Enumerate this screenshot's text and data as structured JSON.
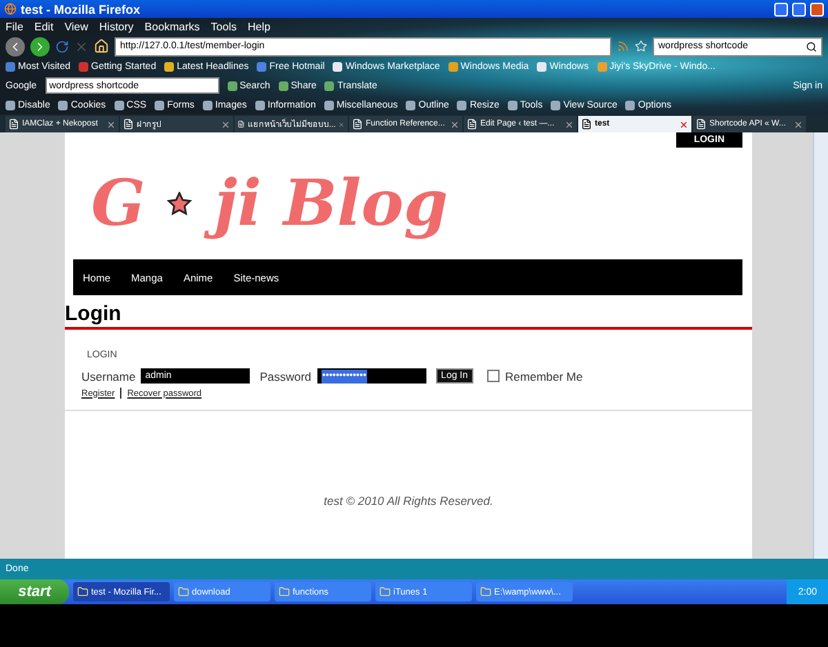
{
  "window": {
    "title": "test - Mozilla Firefox"
  },
  "menu": [
    "File",
    "Edit",
    "View",
    "History",
    "Bookmarks",
    "Tools",
    "Help"
  ],
  "address": {
    "url": "http://127.0.0.1/test/member-login"
  },
  "search": {
    "value": "wordpress shortcode"
  },
  "bookmarks": [
    "Most Visited",
    "Getting Started",
    "Latest Headlines",
    "Free Hotmail",
    "Windows Marketplace",
    "Windows Media",
    "Windows",
    "Jiyi's SkyDrive - Windo..."
  ],
  "google_toolbar": {
    "logo": "Google",
    "query": "wordpress shortcode",
    "buttons": [
      "Search",
      "Share",
      "Translate"
    ],
    "sign_in": "Sign in"
  },
  "webdev_toolbar": [
    "Disable",
    "Cookies",
    "CSS",
    "Forms",
    "Images",
    "Information",
    "Miscellaneous",
    "Outline",
    "Resize",
    "Tools",
    "View Source",
    "Options"
  ],
  "tabs": [
    {
      "label": "IAMClaz + Nekopost",
      "selected": false
    },
    {
      "label": "ฝากรูป",
      "selected": false
    },
    {
      "label": "แยกหน้าเว็บไม่มีขอบบ...",
      "selected": false
    },
    {
      "label": "Function Reference...",
      "selected": false
    },
    {
      "label": "Edit Page ‹ test —...",
      "selected": false
    },
    {
      "label": "test",
      "selected": true
    },
    {
      "label": "Shortcode API « W...",
      "selected": false
    }
  ],
  "page": {
    "login_button": "LOGIN",
    "logo": {
      "before": "G",
      "after": "ji Blog"
    },
    "nav": [
      "Home",
      "Manga",
      "Anime",
      "Site-news"
    ],
    "heading": "Login",
    "form": {
      "section_label": "LOGIN",
      "username_label": "Username",
      "username_value": "admin",
      "password_label": "Password",
      "password_value": "•••••••••••••",
      "submit": "Log In",
      "remember_label": "Remember Me",
      "remember_checked": false
    },
    "links": [
      "Register",
      "Recover password"
    ],
    "footer": "test © 2010 All Rights Reserved."
  },
  "status_bar": {
    "text": "Done"
  },
  "taskbar": {
    "start": "start",
    "tasks": [
      {
        "label": "test - Mozilla Fir...",
        "selected": true
      },
      {
        "label": "download",
        "selected": false
      },
      {
        "label": "functions",
        "selected": false
      },
      {
        "label": "iTunes 1",
        "selected": false
      },
      {
        "label": "E:\\wamp\\www\\...",
        "selected": false
      }
    ],
    "clock": "2:00"
  }
}
